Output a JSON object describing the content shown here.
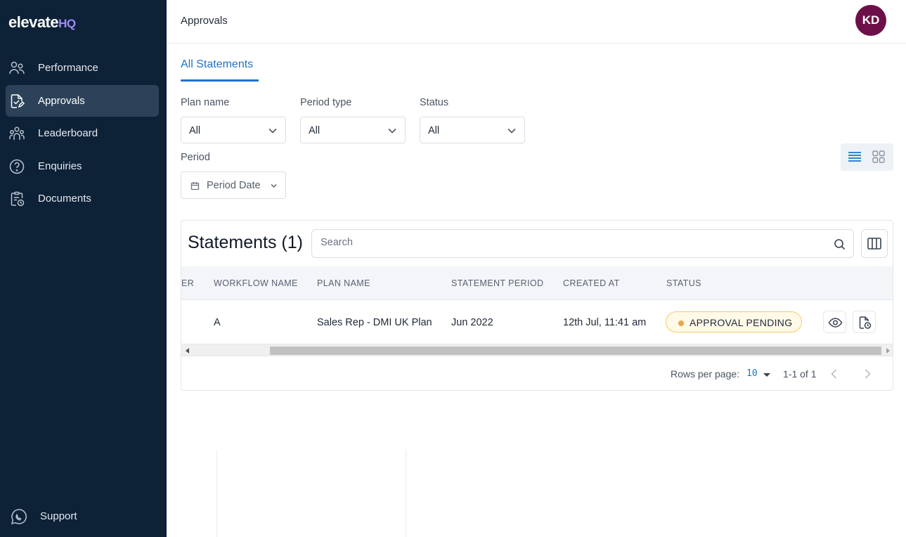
{
  "brand": {
    "name": "elevate",
    "suffix": "HQ"
  },
  "sidebar": {
    "items": [
      {
        "label": "Performance",
        "icon": "users-icon"
      },
      {
        "label": "Approvals",
        "icon": "approval-doc-icon",
        "active": true
      },
      {
        "label": "Leaderboard",
        "icon": "group-icon"
      },
      {
        "label": "Enquiries",
        "icon": "question-icon"
      },
      {
        "label": "Documents",
        "icon": "clipboard-clock-icon"
      }
    ],
    "support": {
      "label": "Support",
      "icon": "chat-icon"
    }
  },
  "header": {
    "title": "Approvals",
    "avatar_initials": "KD",
    "avatar_color": "#6d1049"
  },
  "tabs": [
    {
      "label": "All Statements",
      "active": true
    }
  ],
  "filters": {
    "plan_name": {
      "label": "Plan name",
      "value": "All"
    },
    "period_type": {
      "label": "Period type",
      "value": "All"
    },
    "status": {
      "label": "Status",
      "value": "All"
    },
    "period": {
      "label": "Period",
      "value": "Period Date"
    }
  },
  "view_toggle": {
    "active": "list-view",
    "options": [
      "list-view-icon",
      "grid-view-icon"
    ]
  },
  "statements": {
    "title": "Statements (1)",
    "search_placeholder": "Search",
    "columns": [
      "ER",
      "WORKFLOW NAME",
      "PLAN NAME",
      "STATEMENT PERIOD",
      "CREATED AT",
      "STATUS"
    ],
    "rows": [
      {
        "workflow_name": "A",
        "plan_name": "Sales Rep - DMI UK Plan",
        "statement_period": "Jun 2022",
        "created_at": "12th Jul, 11:41 am",
        "status": "APPROVAL PENDING"
      }
    ],
    "pagination": {
      "rows_per_page_label": "Rows per page:",
      "rows_per_page": "10",
      "range": "1-1 of 1"
    }
  },
  "colors": {
    "accent": "#1f74c8",
    "sidebar_bg": "#0d2137",
    "badge_border": "#f3cc6a",
    "badge_dot": "#e9a64a"
  }
}
